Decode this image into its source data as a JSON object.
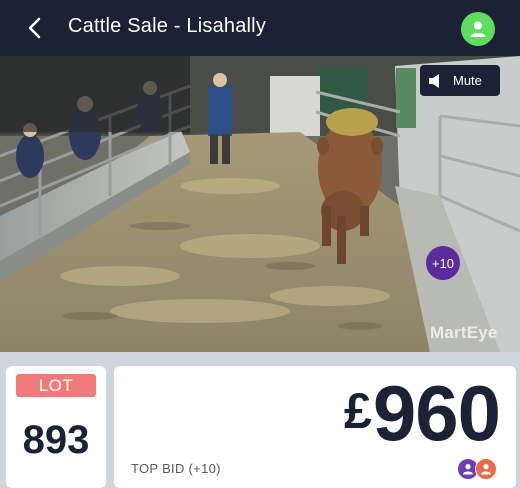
{
  "header": {
    "title": "Cattle Sale - Lisahally",
    "back_icon": "chevron-left-icon",
    "profile_icon": "user-icon",
    "profile_color": "#5fdc5f"
  },
  "video": {
    "mute_label": "Mute",
    "mute_icon": "speaker-icon",
    "plus_badge": "+10",
    "plus_badge_color": "#5a2a9f",
    "watermark": "MartEye"
  },
  "lot": {
    "label": "LOT",
    "number": "893",
    "badge_color": "#f07b7b"
  },
  "bid": {
    "currency": "£",
    "amount": "960",
    "label": "TOP BID (+10)",
    "bidder_colors": [
      "#6b3fb0",
      "#ec6a4c"
    ]
  }
}
